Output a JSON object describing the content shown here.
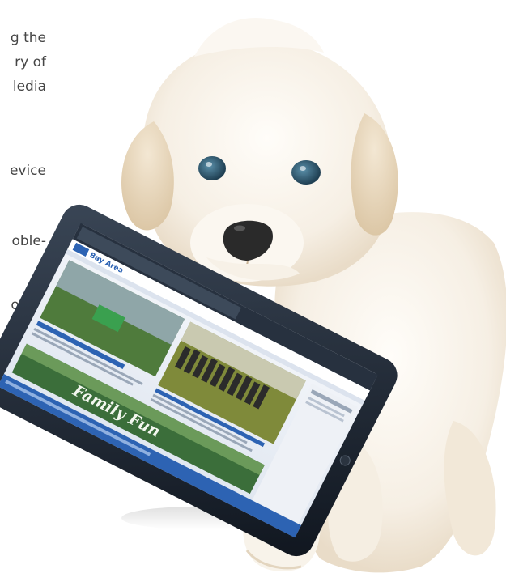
{
  "text_fragments": [
    "g the",
    "ry of",
    "ledia",
    "evice",
    "oble-",
    "orrell"
  ],
  "tablet": {
    "site_name": "Bay Area",
    "banner_text": "Family Fun"
  },
  "colors": {
    "background": "#ffffff",
    "text": "#454545",
    "fur_light": "#f7f2ea",
    "fur_shadow": "#e7d9c4",
    "eye": "#2f5f78",
    "nose": "#2a2a2a",
    "tablet_frame": "#1e2633",
    "screen_blue": "#2d63b3",
    "screen_green": "#4f7b3c"
  }
}
